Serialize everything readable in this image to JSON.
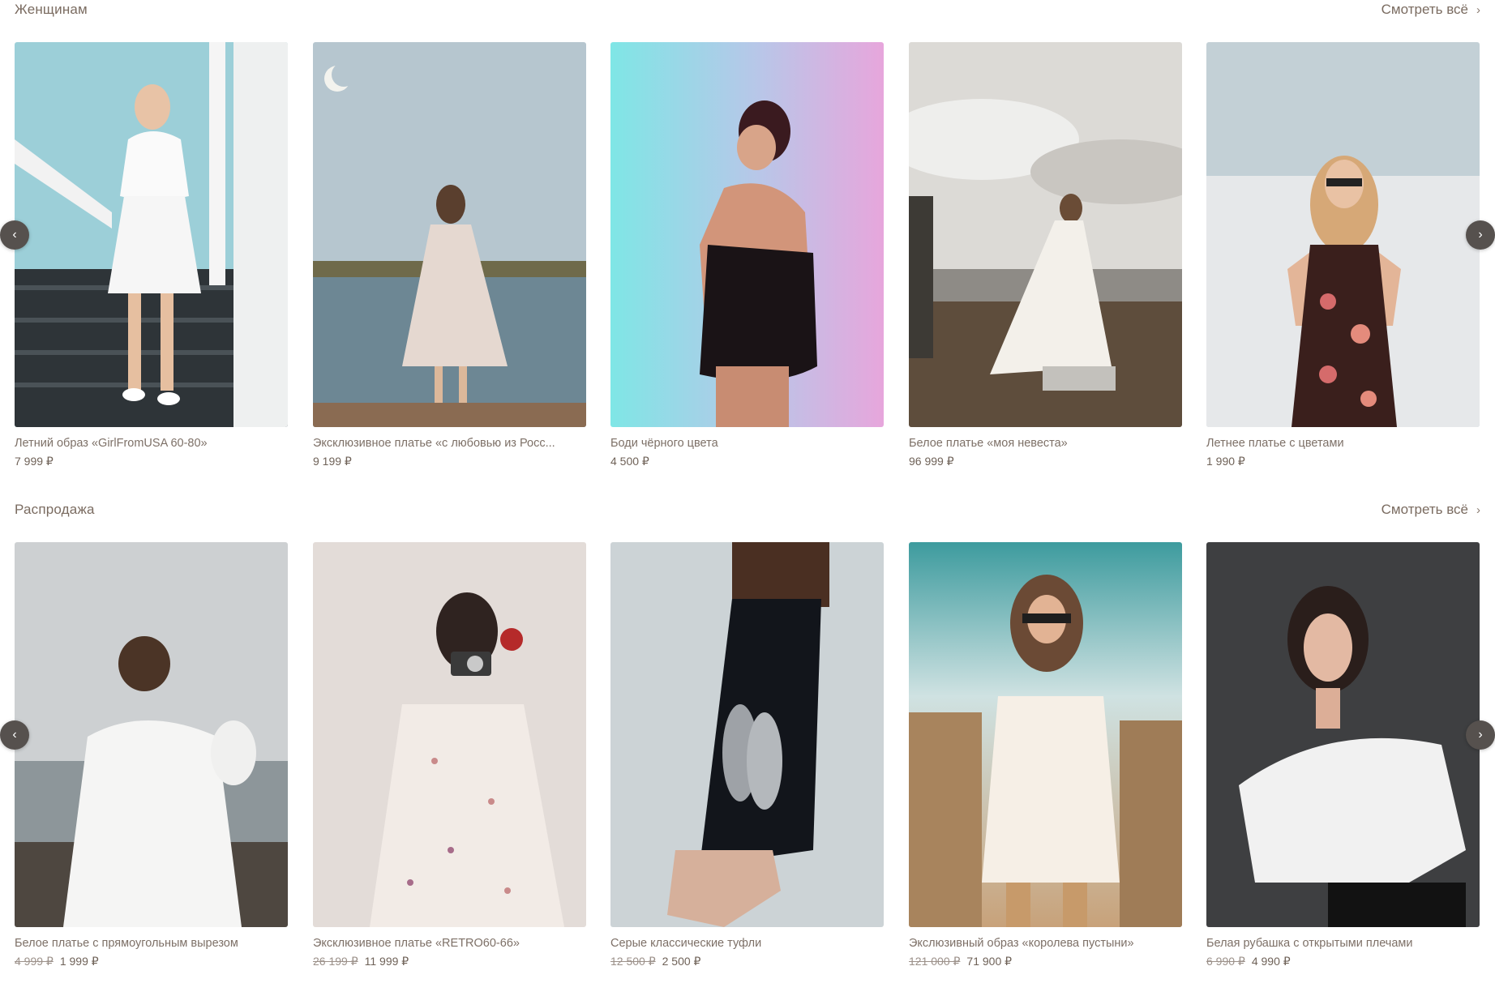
{
  "sections": [
    {
      "title": "Женщинам",
      "see_all": "Смотреть всё",
      "products": [
        {
          "name": "Летний образ «GirlFromUSA 60-80»",
          "price": "7 999 ₽"
        },
        {
          "name": "Эксклюзивное платье «с любовью из Росс...",
          "price": "9 199 ₽"
        },
        {
          "name": "Боди чёрного цвета",
          "price": "4 500 ₽"
        },
        {
          "name": "Белое платье «моя невеста»",
          "price": "96 999 ₽"
        },
        {
          "name": "Летнее платье с цветами",
          "price": "1 990 ₽"
        }
      ]
    },
    {
      "title": "Распродажа",
      "see_all": "Смотреть всё",
      "products": [
        {
          "name": "Белое платье с прямоугольным вырезом",
          "old_price": "4 999 ₽",
          "price": "1 999 ₽"
        },
        {
          "name": "Эксклюзивное платье «RETRO60-66»",
          "old_price": "26 199 ₽",
          "price": "11 999 ₽"
        },
        {
          "name": "Серые классические туфли",
          "old_price": "12 500 ₽",
          "price": "2 500 ₽"
        },
        {
          "name": "Экслюзивный образ «королева пустыни»",
          "old_price": "121 000 ₽",
          "price": "71 900 ₽"
        },
        {
          "name": "Белая рубашка с открытыми плечами",
          "old_price": "6 990 ₽",
          "price": "4 990 ₽"
        }
      ]
    }
  ],
  "nav": {
    "prev": "‹",
    "next": "›",
    "chevron": "›"
  }
}
